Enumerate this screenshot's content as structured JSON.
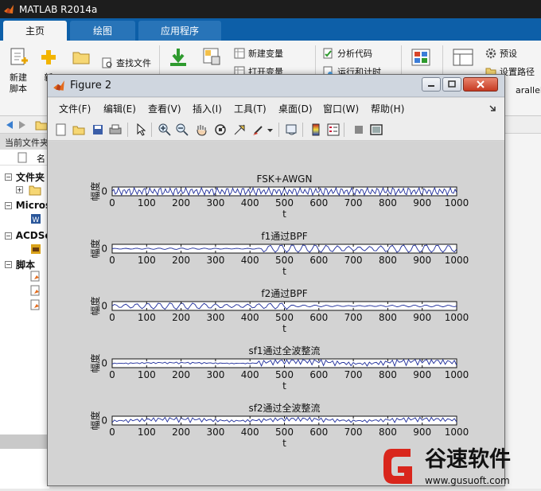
{
  "app": {
    "title": "MATLAB R2014a"
  },
  "ribbon": {
    "tabs": [
      "主页",
      "绘图",
      "应用程序"
    ],
    "new_script": "新建\n脚本",
    "new": "新",
    "find_files": "查找文件",
    "new_variable": "新建变量",
    "open_variable": "打开变量",
    "analyze_code": "分析代码",
    "run_and_time": "运行和计时",
    "preferences": "预设",
    "set_path": "设置路径",
    "parallel": "arallel"
  },
  "current_folder": {
    "header": "当前文件夹",
    "name_col": "名",
    "items": [
      {
        "label": "文件夹",
        "toggle": "−"
      },
      {
        "label": "Micros",
        "toggle": "−"
      },
      {
        "label": "ACDSe",
        "toggle": "−"
      },
      {
        "label": "脚本",
        "toggle": "−"
      }
    ]
  },
  "figure": {
    "title": "Figure 2",
    "menu": [
      "文件(F)",
      "编辑(E)",
      "查看(V)",
      "插入(I)",
      "工具(T)",
      "桌面(D)",
      "窗口(W)",
      "帮助(H)"
    ],
    "toolbar_icons": [
      "new-figure-icon",
      "open-icon",
      "save-icon",
      "print-icon",
      "pointer-icon",
      "zoom-in-icon",
      "zoom-out-icon",
      "pan-icon",
      "rotate-3d-icon",
      "data-cursor-icon",
      "brush-icon",
      "link-icon",
      "colorbar-icon",
      "legend-icon",
      "hide-tools-icon",
      "show-tools-icon"
    ]
  },
  "chart_data": [
    {
      "type": "line",
      "title": "FSK+AWGN",
      "xlabel": "t",
      "ylabel": "幅度",
      "xlim": [
        0,
        1000
      ],
      "xticks": [
        0,
        100,
        200,
        300,
        400,
        500,
        600,
        700,
        800,
        900,
        1000
      ],
      "yticks": [
        "0"
      ],
      "pattern": "dense-full"
    },
    {
      "type": "line",
      "title": "f1通过BPF",
      "xlabel": "t",
      "ylabel": "幅度",
      "xlim": [
        0,
        1000
      ],
      "xticks": [
        0,
        100,
        200,
        300,
        400,
        500,
        600,
        700,
        800,
        900,
        1000
      ],
      "yticks": [
        "0"
      ],
      "pattern": "burst-second-half"
    },
    {
      "type": "line",
      "title": "f2通过BPF",
      "xlabel": "t",
      "ylabel": "幅度",
      "xlim": [
        0,
        1000
      ],
      "xticks": [
        0,
        100,
        200,
        300,
        400,
        500,
        600,
        700,
        800,
        900,
        1000
      ],
      "yticks": [
        "0"
      ],
      "pattern": "burst-first-half"
    },
    {
      "type": "line",
      "title": "sf1通过全波整流",
      "xlabel": "t",
      "ylabel": "幅度",
      "xlim": [
        0,
        1000
      ],
      "xticks": [
        0,
        100,
        200,
        300,
        400,
        500,
        600,
        700,
        800,
        900,
        1000
      ],
      "yticks": [
        "0"
      ],
      "pattern": "rectified-second-half"
    },
    {
      "type": "line",
      "title": "sf2通过全波整流",
      "xlabel": "t",
      "ylabel": "幅度",
      "xlim": [
        0,
        1000
      ],
      "xticks": [
        0,
        100,
        200,
        300,
        400,
        500,
        600,
        700,
        800,
        900,
        1000
      ],
      "yticks": [
        "0"
      ],
      "pattern": "rectified-first-half"
    }
  ],
  "watermark": {
    "brand": "谷速软件",
    "url": "www.gusuoft.com"
  },
  "colors": {
    "line": "#1b2a9a",
    "ribbon_tab": "#0d5fa8",
    "watermark": "#d9261c"
  }
}
